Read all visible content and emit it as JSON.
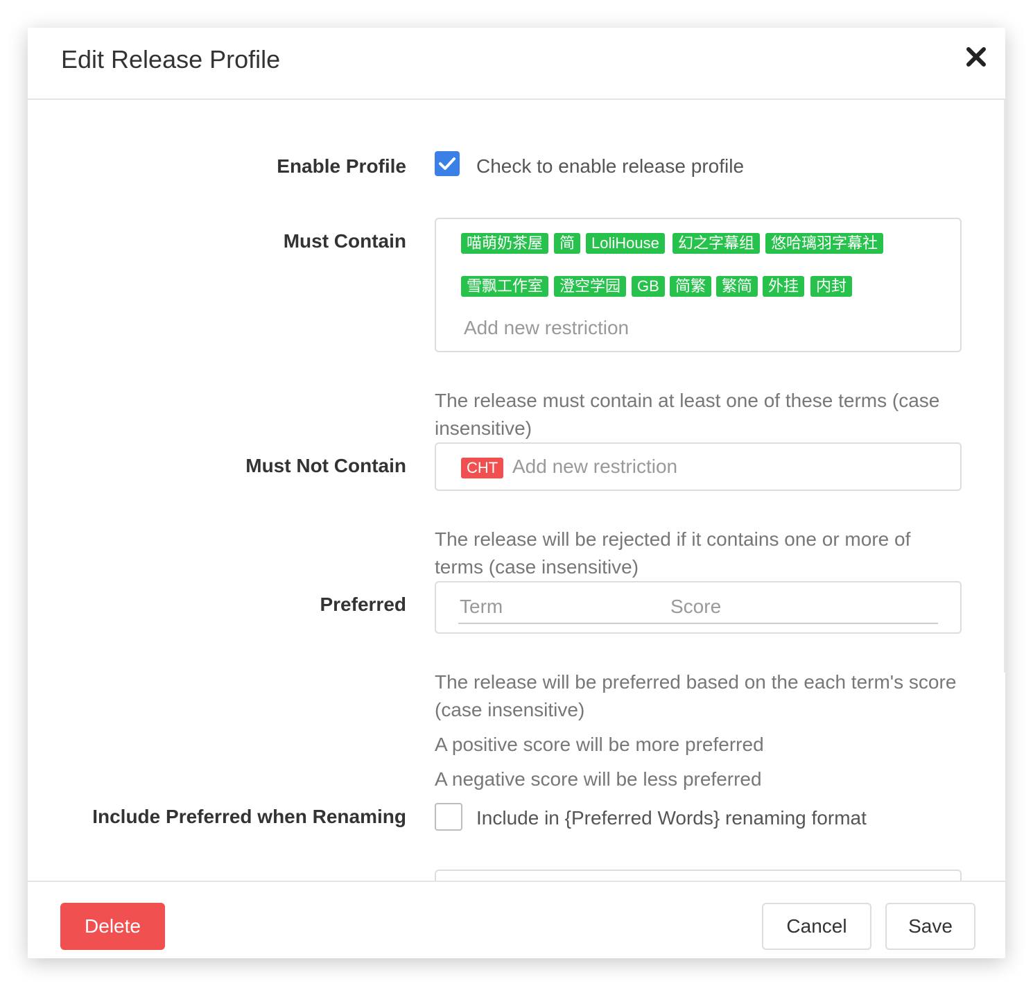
{
  "modal": {
    "title": "Edit Release Profile"
  },
  "enable_profile": {
    "label": "Enable Profile",
    "checked": true,
    "text": "Check to enable release profile"
  },
  "must_contain": {
    "label": "Must Contain",
    "tags": [
      "喵萌奶茶屋",
      "简",
      "LoliHouse",
      "幻之字幕组",
      "悠哈璃羽字幕社",
      "雪飘工作室",
      "澄空学园",
      "GB",
      "简繁",
      "繁简",
      "外挂",
      "内封"
    ],
    "tag_color": "#27c24c",
    "placeholder": "Add new restriction",
    "help": "The release must contain at least one of these terms (case insensitive)"
  },
  "must_not_contain": {
    "label": "Must Not Contain",
    "tags": [
      "CHT"
    ],
    "tag_color": "#f05050",
    "placeholder": "Add new restriction",
    "help": "The release will be rejected if it contains one or more of terms (case insensitive)"
  },
  "preferred": {
    "label": "Preferred",
    "term_placeholder": "Term",
    "score_placeholder": "Score",
    "help": "The release will be preferred based on the each term's score (case insensitive)",
    "help_positive": "A positive score will be more preferred",
    "help_negative": "A negative score will be less preferred"
  },
  "include_preferred": {
    "label": "Include Preferred when Renaming",
    "checked": false,
    "text": "Include in {Preferred Words} renaming format"
  },
  "footer": {
    "delete_label": "Delete",
    "cancel_label": "Cancel",
    "save_label": "Save",
    "delete_color": "#f05050"
  },
  "icons": {
    "close": "close-icon",
    "check": "checkmark-icon"
  },
  "colors": {
    "accent": "#3a80e6"
  }
}
